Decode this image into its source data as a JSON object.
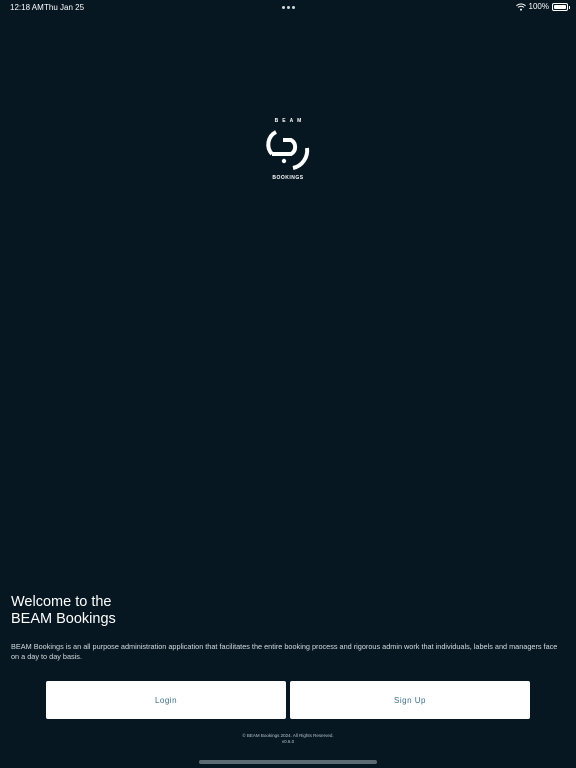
{
  "status_bar": {
    "time": "12:18 AM",
    "date": "Thu Jan 25",
    "battery": "100%",
    "icons": [
      "multitasking-dots-icon",
      "wifi-icon",
      "battery-icon"
    ]
  },
  "logo": {
    "top_text": "BEAM",
    "bottom_text": "BOOKINGS",
    "icon": "beam-logo-icon"
  },
  "welcome": {
    "line1": "Welcome to the",
    "line2": "BEAM Bookings",
    "description": "BEAM Bookings is an all purpose administration application that facilitates the entire booking process and rigorous admin work that individuals, labels and managers face on a day to day basis."
  },
  "buttons": {
    "login": "Login",
    "signup": "Sign Up"
  },
  "footer": {
    "copyright": "© BEAM Bookings 2024. All Rights Reserved.",
    "version": "v0.6.0"
  },
  "colors": {
    "background": "#071722",
    "button_bg": "#ffffff",
    "button_text": "#3c6f88"
  }
}
